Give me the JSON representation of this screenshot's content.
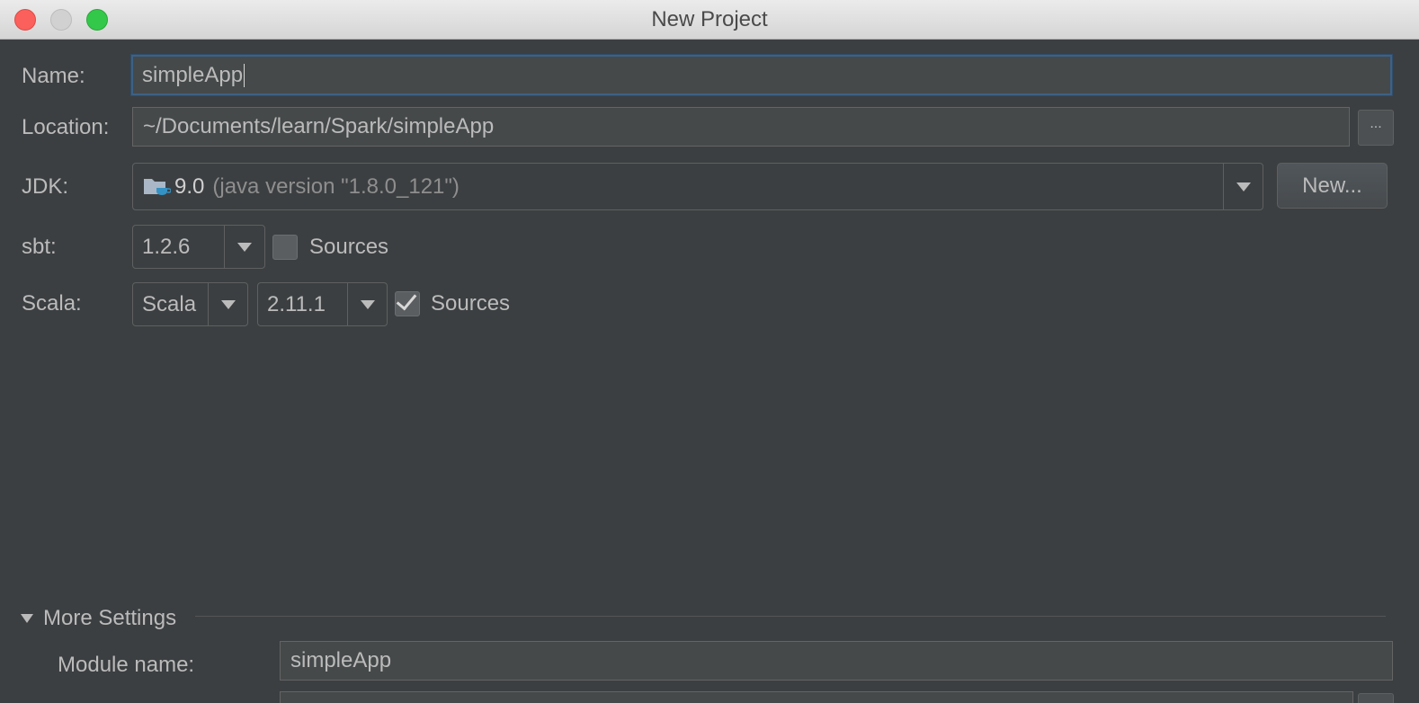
{
  "window": {
    "title": "New Project"
  },
  "name": {
    "label": "Name:",
    "value": "simpleApp"
  },
  "location": {
    "label": "Location:",
    "value": "~/Documents/learn/Spark/simpleApp",
    "browse_label": "..."
  },
  "jdk": {
    "label": "JDK:",
    "version": "9.0",
    "detail": "(java version \"1.8.0_121\")",
    "new_button": "New..."
  },
  "sbt": {
    "label": "sbt:",
    "version": "1.2.6",
    "sources_label": "Sources",
    "sources_checked": false
  },
  "scala": {
    "label": "Scala:",
    "distribution": "Scala",
    "version": "2.11.1",
    "sources_label": "Sources",
    "sources_checked": true
  },
  "more_settings": {
    "label": "More Settings",
    "module_name_label": "Module name:",
    "module_name_value": "simpleApp"
  },
  "colors": {
    "background": "#3c3f41",
    "field_bg": "#45494a",
    "focus_border": "#3d6185",
    "text": "#bbbbbb",
    "close": "#fc605c",
    "maximize": "#34c84a"
  }
}
